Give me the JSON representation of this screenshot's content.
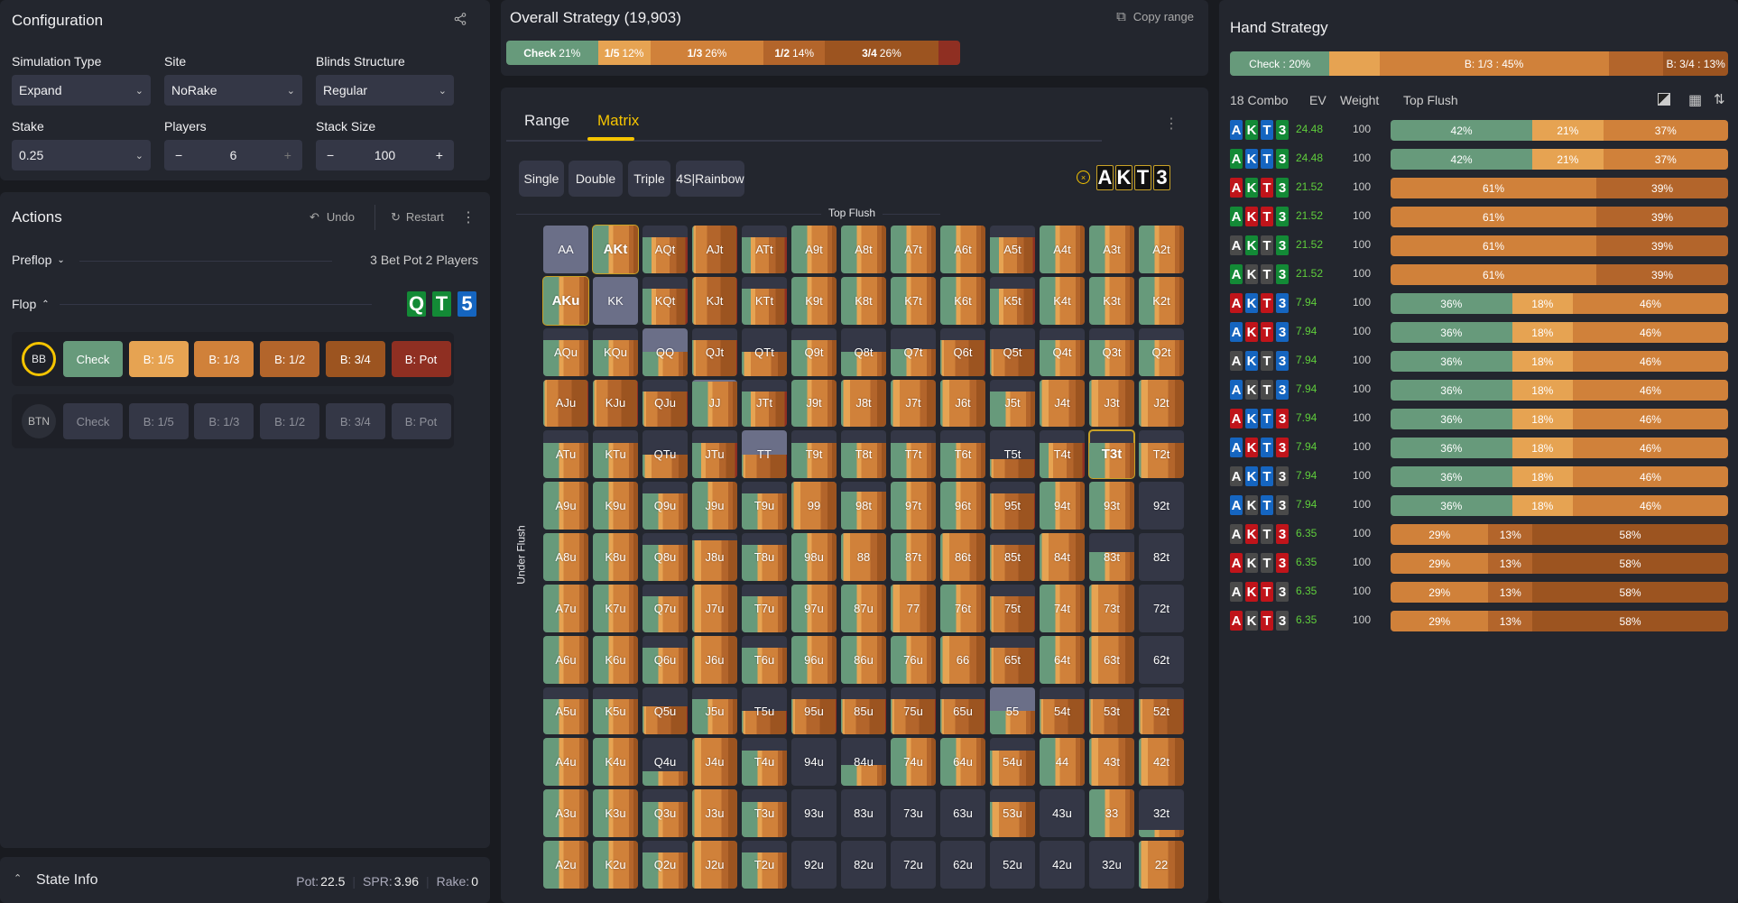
{
  "colors": {
    "check": "#679a7b",
    "b15": "#e6a352",
    "b13": "#d0813a",
    "b12": "#b3652b",
    "b34": "#9c5420",
    "pot": "#8f2f22",
    "accent": "#f5c400",
    "ev": "#5fce3c",
    "suit_blue": "#1565c0",
    "suit_green": "#138a36",
    "suit_red": "#c0141a",
    "suit_gray": "#4a4a4a"
  },
  "config": {
    "title": "Configuration",
    "simulation_type": {
      "label": "Simulation Type",
      "value": "Expand"
    },
    "site": {
      "label": "Site",
      "value": "NoRake"
    },
    "blinds": {
      "label": "Blinds Structure",
      "value": "Regular"
    },
    "stake": {
      "label": "Stake",
      "value": "0.25"
    },
    "players": {
      "label": "Players",
      "value": "6"
    },
    "stack": {
      "label": "Stack Size",
      "value": "100"
    }
  },
  "actions": {
    "title": "Actions",
    "undo": "Undo",
    "restart": "Restart",
    "preflop": {
      "label": "Preflop",
      "summary": "3 Bet Pot 2 Players"
    },
    "flop": {
      "label": "Flop",
      "cards": [
        {
          "rank": "Q",
          "suit": "green"
        },
        {
          "rank": "T",
          "suit": "green"
        },
        {
          "rank": "5",
          "suit": "blue"
        }
      ]
    },
    "players": [
      {
        "name": "BB",
        "active": true,
        "buttons": [
          "Check",
          "B: 1/5",
          "B: 1/3",
          "B: 1/2",
          "B: 3/4",
          "B: Pot"
        ]
      },
      {
        "name": "BTN",
        "active": false,
        "buttons": [
          "Check",
          "B: 1/5",
          "B: 1/3",
          "B: 1/2",
          "B: 3/4",
          "B: Pot"
        ]
      }
    ]
  },
  "state_info": {
    "title": "State Info",
    "pot_label": "Pot:",
    "pot": "22.5",
    "spr_label": "SPR:",
    "spr": "3.96",
    "rake_label": "Rake:",
    "rake": "0"
  },
  "overall": {
    "title": "Overall Strategy (19,903)",
    "copy_label": "Copy range",
    "segments": [
      {
        "name": "Check",
        "pct": "21%",
        "value": 21,
        "color": "check"
      },
      {
        "name": "1/5",
        "pct": "12%",
        "value": 12,
        "color": "b15"
      },
      {
        "name": "1/3",
        "pct": "26%",
        "value": 26,
        "color": "b13"
      },
      {
        "name": "1/2",
        "pct": "14%",
        "value": 14,
        "color": "b12"
      },
      {
        "name": "3/4",
        "pct": "26%",
        "value": 26,
        "color": "b34"
      },
      {
        "name": "",
        "pct": "",
        "value": 5,
        "color": "pot"
      }
    ]
  },
  "matrix": {
    "tabs": [
      "Range",
      "Matrix"
    ],
    "active_tab": 1,
    "filters": [
      "Single",
      "Double",
      "Triple",
      "4S|Rainbow"
    ],
    "selected_hand": [
      "A",
      "K",
      "T",
      "3"
    ],
    "top_label": "Top Flush",
    "side_label": "Under Flush",
    "profiles": {
      "g": [
        35,
        10,
        35,
        10,
        10,
        0
      ],
      "m": [
        20,
        10,
        30,
        15,
        20,
        5
      ],
      "o": [
        5,
        15,
        45,
        15,
        20,
        0
      ],
      "b": [
        3,
        5,
        25,
        30,
        35,
        2
      ],
      "p": [
        35,
        10,
        35,
        10,
        10,
        0
      ],
      "n": [
        0,
        0,
        0,
        0,
        0,
        0
      ]
    },
    "labels": [
      [
        "AA",
        "AKt",
        "AQt",
        "AJt",
        "ATt",
        "A9t",
        "A8t",
        "A7t",
        "A6t",
        "A5t",
        "A4t",
        "A3t",
        "A2t"
      ],
      [
        "AKu",
        "KK",
        "KQt",
        "KJt",
        "KTt",
        "K9t",
        "K8t",
        "K7t",
        "K6t",
        "K5t",
        "K4t",
        "K3t",
        "K2t"
      ],
      [
        "AQu",
        "KQu",
        "QQ",
        "QJt",
        "QTt",
        "Q9t",
        "Q8t",
        "Q7t",
        "Q6t",
        "Q5t",
        "Q4t",
        "Q3t",
        "Q2t"
      ],
      [
        "AJu",
        "KJu",
        "QJu",
        "JJ",
        "JTt",
        "J9t",
        "J8t",
        "J7t",
        "J6t",
        "J5t",
        "J4t",
        "J3t",
        "J2t"
      ],
      [
        "ATu",
        "KTu",
        "QTu",
        "JTu",
        "TT",
        "T9t",
        "T8t",
        "T7t",
        "T6t",
        "T5t",
        "T4t",
        "T3t",
        "T2t"
      ],
      [
        "A9u",
        "K9u",
        "Q9u",
        "J9u",
        "T9u",
        "99",
        "98t",
        "97t",
        "96t",
        "95t",
        "94t",
        "93t",
        "92t"
      ],
      [
        "A8u",
        "K8u",
        "Q8u",
        "J8u",
        "T8u",
        "98u",
        "88",
        "87t",
        "86t",
        "85t",
        "84t",
        "83t",
        "82t"
      ],
      [
        "A7u",
        "K7u",
        "Q7u",
        "J7u",
        "T7u",
        "97u",
        "87u",
        "77",
        "76t",
        "75t",
        "74t",
        "73t",
        "72t"
      ],
      [
        "A6u",
        "K6u",
        "Q6u",
        "J6u",
        "T6u",
        "96u",
        "86u",
        "76u",
        "66",
        "65t",
        "64t",
        "63t",
        "62t"
      ],
      [
        "A5u",
        "K5u",
        "Q5u",
        "J5u",
        "T5u",
        "95u",
        "85u",
        "75u",
        "65u",
        "55",
        "54t",
        "53t",
        "52t"
      ],
      [
        "A4u",
        "K4u",
        "Q4u",
        "J4u",
        "T4u",
        "94u",
        "84u",
        "74u",
        "64u",
        "54u",
        "44",
        "43t",
        "42t"
      ],
      [
        "A3u",
        "K3u",
        "Q3u",
        "J3u",
        "T3u",
        "93u",
        "83u",
        "73u",
        "63u",
        "53u",
        "43u",
        "33",
        "32t"
      ],
      [
        "A2u",
        "K2u",
        "Q2u",
        "J2u",
        "T2u",
        "92u",
        "82u",
        "72u",
        "62u",
        "52u",
        "42u",
        "32u",
        "22"
      ]
    ],
    "fill": [
      [
        0,
        1,
        0.75,
        1,
        0.75,
        1,
        1,
        1,
        1,
        0.75,
        1,
        1,
        1
      ],
      [
        1,
        0,
        0.75,
        1,
        0.75,
        1,
        1,
        1,
        1,
        0.75,
        1,
        1,
        1
      ],
      [
        0.75,
        0.75,
        0.5,
        0.75,
        0.5,
        0.75,
        0.5,
        0.55,
        0.75,
        0.55,
        0.75,
        0.75,
        0.75
      ],
      [
        1,
        1,
        0.75,
        0.95,
        0.75,
        1,
        1,
        1,
        1,
        0.75,
        1,
        1,
        1
      ],
      [
        0.75,
        0.75,
        0.5,
        0.75,
        0.5,
        0.75,
        0.75,
        0.75,
        0.75,
        0.4,
        0.75,
        0.75,
        0.75
      ],
      [
        1,
        1,
        0.75,
        1,
        0.75,
        1,
        0.8,
        1,
        1,
        0.75,
        1,
        1,
        0
      ],
      [
        1,
        1,
        0.75,
        0.85,
        0.75,
        1,
        1,
        1,
        1,
        0.75,
        1,
        0.6,
        0
      ],
      [
        1,
        1,
        0.75,
        1,
        0.75,
        1,
        1,
        1,
        1,
        0.75,
        1,
        1,
        0
      ],
      [
        1,
        1,
        0.75,
        1,
        0.75,
        1,
        1,
        1,
        1,
        0.75,
        1,
        1,
        0
      ],
      [
        0.75,
        0.75,
        0.6,
        0.75,
        0.5,
        0.75,
        0.75,
        0.75,
        0.75,
        0.5,
        0.75,
        0.75,
        0.75
      ],
      [
        1,
        1,
        0.3,
        1,
        0.75,
        0,
        0.45,
        1,
        1,
        0.75,
        1,
        1,
        1
      ],
      [
        1,
        1,
        0.75,
        1,
        0.75,
        0,
        0,
        0,
        0,
        0.75,
        0,
        1,
        0.15
      ],
      [
        1,
        1,
        0.75,
        1,
        0.75,
        0,
        0,
        0,
        0,
        0,
        0,
        0,
        1
      ]
    ],
    "mix": [
      "pgmbmggggmggg",
      "gpmbmggggmggg",
      "ggpbogggbbggg",
      "bbbpmgooogooo",
      "ggombggggbmgo",
      "gggggogggbggn",
      "gggoggogobogn",
      "gggogggogbgon",
      "gggoggggobgon",
      "ggbgbbbbbpbbb",
      "gggogngggogoo",
      "gggognnnnongg",
      "gggognnnnnnno"
    ],
    "selected_cells": [
      "AKt",
      "AKu",
      "T3t"
    ]
  },
  "hand": {
    "title": "Hand Strategy",
    "segments": [
      {
        "label": "Check : 20%",
        "value": 20,
        "color": "check"
      },
      {
        "label": "",
        "value": 10,
        "color": "b15"
      },
      {
        "label": "B: 1/3 : 45%",
        "value": 46,
        "color": "b13"
      },
      {
        "label": "",
        "value": 11,
        "color": "b12"
      },
      {
        "label": "B: 3/4 : 13%",
        "value": 13,
        "color": "b34"
      }
    ],
    "headers": {
      "combo": "18 Combo",
      "ev": "EV",
      "weight": "Weight",
      "category": "Top Flush"
    },
    "rows": [
      {
        "suits": "bgbg",
        "ev": "24.48",
        "weight": "100",
        "strat": [
          {
            "v": 42,
            "c": "check"
          },
          {
            "v": 21,
            "c": "b15"
          },
          {
            "v": 37,
            "c": "b13"
          }
        ]
      },
      {
        "suits": "gbbg",
        "ev": "24.48",
        "weight": "100",
        "strat": [
          {
            "v": 42,
            "c": "check"
          },
          {
            "v": 21,
            "c": "b15"
          },
          {
            "v": 37,
            "c": "b13"
          }
        ]
      },
      {
        "suits": "rgrg",
        "ev": "21.52",
        "weight": "100",
        "strat": [
          {
            "v": 61,
            "c": "b13"
          },
          {
            "v": 39,
            "c": "b12"
          }
        ]
      },
      {
        "suits": "grrg",
        "ev": "21.52",
        "weight": "100",
        "strat": [
          {
            "v": 61,
            "c": "b13"
          },
          {
            "v": 39,
            "c": "b12"
          }
        ]
      },
      {
        "suits": "kgkg",
        "ev": "21.52",
        "weight": "100",
        "strat": [
          {
            "v": 61,
            "c": "b13"
          },
          {
            "v": 39,
            "c": "b12"
          }
        ]
      },
      {
        "suits": "gkkg",
        "ev": "21.52",
        "weight": "100",
        "strat": [
          {
            "v": 61,
            "c": "b13"
          },
          {
            "v": 39,
            "c": "b12"
          }
        ]
      },
      {
        "suits": "rbrb",
        "ev": "7.94",
        "weight": "100",
        "strat": [
          {
            "v": 36,
            "c": "check"
          },
          {
            "v": 18,
            "c": "b15"
          },
          {
            "v": 46,
            "c": "b13"
          }
        ]
      },
      {
        "suits": "brrb",
        "ev": "7.94",
        "weight": "100",
        "strat": [
          {
            "v": 36,
            "c": "check"
          },
          {
            "v": 18,
            "c": "b15"
          },
          {
            "v": 46,
            "c": "b13"
          }
        ]
      },
      {
        "suits": "kbkb",
        "ev": "7.94",
        "weight": "100",
        "strat": [
          {
            "v": 36,
            "c": "check"
          },
          {
            "v": 18,
            "c": "b15"
          },
          {
            "v": 46,
            "c": "b13"
          }
        ]
      },
      {
        "suits": "bkkb",
        "ev": "7.94",
        "weight": "100",
        "strat": [
          {
            "v": 36,
            "c": "check"
          },
          {
            "v": 18,
            "c": "b15"
          },
          {
            "v": 46,
            "c": "b13"
          }
        ]
      },
      {
        "suits": "rbbr",
        "ev": "7.94",
        "weight": "100",
        "strat": [
          {
            "v": 36,
            "c": "check"
          },
          {
            "v": 18,
            "c": "b15"
          },
          {
            "v": 46,
            "c": "b13"
          }
        ]
      },
      {
        "suits": "brbr",
        "ev": "7.94",
        "weight": "100",
        "strat": [
          {
            "v": 36,
            "c": "check"
          },
          {
            "v": 18,
            "c": "b15"
          },
          {
            "v": 46,
            "c": "b13"
          }
        ]
      },
      {
        "suits": "kbbk",
        "ev": "7.94",
        "weight": "100",
        "strat": [
          {
            "v": 36,
            "c": "check"
          },
          {
            "v": 18,
            "c": "b15"
          },
          {
            "v": 46,
            "c": "b13"
          }
        ]
      },
      {
        "suits": "bkbk",
        "ev": "7.94",
        "weight": "100",
        "strat": [
          {
            "v": 36,
            "c": "check"
          },
          {
            "v": 18,
            "c": "b15"
          },
          {
            "v": 46,
            "c": "b13"
          }
        ]
      },
      {
        "suits": "krkr",
        "ev": "6.35",
        "weight": "100",
        "strat": [
          {
            "v": 29,
            "c": "b13"
          },
          {
            "v": 13,
            "c": "b12"
          },
          {
            "v": 58,
            "c": "b34"
          }
        ]
      },
      {
        "suits": "rkkr",
        "ev": "6.35",
        "weight": "100",
        "strat": [
          {
            "v": 29,
            "c": "b13"
          },
          {
            "v": 13,
            "c": "b12"
          },
          {
            "v": 58,
            "c": "b34"
          }
        ]
      },
      {
        "suits": "krrk",
        "ev": "6.35",
        "weight": "100",
        "strat": [
          {
            "v": 29,
            "c": "b13"
          },
          {
            "v": 13,
            "c": "b12"
          },
          {
            "v": 58,
            "c": "b34"
          }
        ]
      },
      {
        "suits": "rkrk",
        "ev": "6.35",
        "weight": "100",
        "strat": [
          {
            "v": 29,
            "c": "b13"
          },
          {
            "v": 13,
            "c": "b12"
          },
          {
            "v": 58,
            "c": "b34"
          }
        ]
      }
    ],
    "ranks": [
      "A",
      "K",
      "T",
      "3"
    ]
  }
}
